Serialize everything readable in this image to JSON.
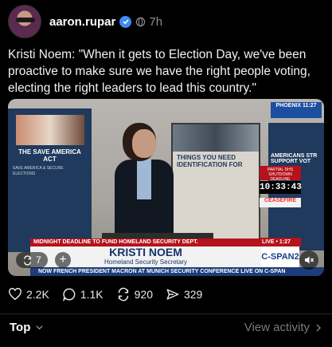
{
  "post": {
    "author": "aaron.rupar",
    "time": "7h",
    "text": "Kristi Noem: \"When it gets to Election Day, we've been proactive to make sure we have the right people voting, electing the right leaders to lead this country.\""
  },
  "video": {
    "left_poster_title": "THE SAVE AMERICA ACT",
    "left_poster_footer": "SAVE AMERICA & SECURE ELECTIONS",
    "screen_title": "THINGS YOU NEED IDENTIFICATION FOR",
    "right_screen_title": "AMERICANS STR SUPPORT VOT",
    "station_tag": "PHOENIX 11:27",
    "partial_shutdown": "PARTIAL DHS SHUTDOWN DEADLINE",
    "clock": "10:33:43",
    "ceasefire": "CEASEFIRE",
    "live": "LIVE • 1:27",
    "deadline_banner": "MIDNIGHT DEADLINE TO FUND HOMELAND SECURITY DEPT.",
    "speaker_name": "KRISTI NOEM",
    "speaker_title": "Homeland Security Secretary",
    "network": "C-SPAN2",
    "ticker": "NOW  FRENCH PRESIDENT MACRON AT MUNICH SECURITY CONFERENCE  LIVE ON C-SPAN",
    "repost_count": "7"
  },
  "actions": {
    "likes": "2.2K",
    "replies": "1.1K",
    "reposts": "920",
    "shares": "329"
  },
  "footer": {
    "sort_label": "Top",
    "view_activity": "View activity"
  }
}
